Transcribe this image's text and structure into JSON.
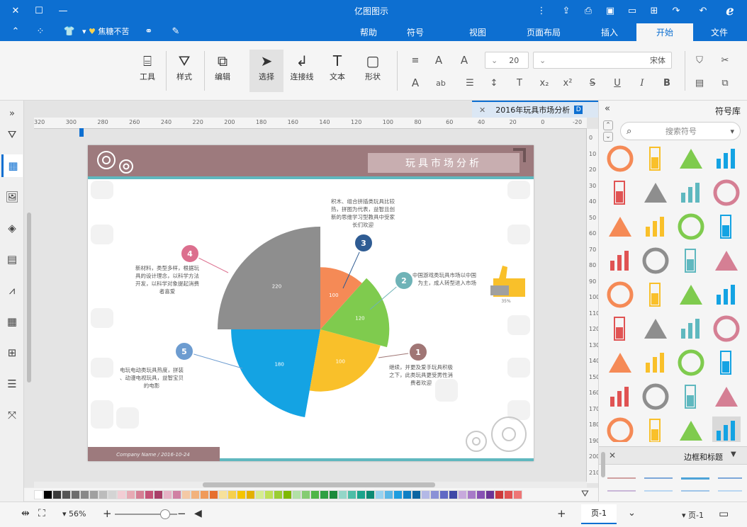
{
  "app": {
    "title": "亿图图示"
  },
  "menu": {
    "file": "文件",
    "start": "开始",
    "insert": "插入",
    "page_layout": "页面布局",
    "view": "视图",
    "symbol": "符号",
    "help": "帮助",
    "user_name": "焦糖不苦",
    "active": "开始"
  },
  "ribbon": {
    "tools": {
      "tool": "工具",
      "style": "样式",
      "edit": "编辑",
      "select": "选择",
      "connector": "连接线",
      "text": "文本",
      "shape": "形状"
    },
    "font": {
      "name": "宋体",
      "size": "20"
    },
    "text_buttons": {
      "increase": "A",
      "decrease": "A",
      "bold": "B",
      "italic": "I",
      "underline": "U",
      "strike": "S",
      "superscript": "x²",
      "subscript": "x₂",
      "text_t": "T",
      "ab": "ab",
      "font_color": "A"
    }
  },
  "document": {
    "tab_title": "2016年玩具市场分析"
  },
  "ruler": {
    "horizontal": [
      "-20",
      "0",
      "20",
      "40",
      "60",
      "80",
      "100",
      "120",
      "140",
      "160",
      "180",
      "200",
      "220",
      "240",
      "260",
      "280",
      "300",
      "320"
    ],
    "vertical": [
      "0",
      "10",
      "20",
      "30",
      "40",
      "50",
      "60",
      "70",
      "80",
      "90",
      "100",
      "110",
      "120",
      "130",
      "140",
      "150",
      "160",
      "170",
      "180",
      "190",
      "200",
      "210"
    ]
  },
  "slide": {
    "title": "玩具市场分析",
    "footer": "Company Name  /  2016-10-24",
    "accent_colors": {
      "header": "#9d7a7d",
      "teal": "#5fb8bf"
    },
    "callouts": [
      {
        "num": "1",
        "color": "#a07675",
        "text": "继续，并更及爱手玩具积极之下，此类玩具更受男性消费者欢迎"
      },
      {
        "num": "2",
        "color": "#6fb3b7",
        "text": "中国游戏类玩具市场以中国为主，成人转型进入市场"
      },
      {
        "num": "3",
        "color": "#2f5c93",
        "text": "积木、组合拼插类玩具比较热，拼图为代表，益智且创新的思维学习型教具中受家长们欢迎"
      },
      {
        "num": "4",
        "color": "#dc6f8e",
        "text": "新材料，类型多样，根据玩具的设计理念，以科学方法开发，以科学对象提起消费者喜爱"
      },
      {
        "num": "5",
        "color": "#6d9cd0",
        "text": "电玩电动类玩具热度，拼装、动漫电视玩具，益智宝贝的电影"
      }
    ],
    "thumb_note": "35%"
  },
  "chart_data": {
    "type": "pie",
    "categories": [
      "1",
      "2",
      "3",
      "4",
      "5"
    ],
    "values": [
      100,
      120,
      100,
      220,
      180
    ],
    "colors": [
      "#f9c02a",
      "#7fcb4e",
      "#f58a56",
      "#8e8e8e",
      "#14a3e3"
    ],
    "title": "",
    "legend": "none"
  },
  "palette_colors": [
    "#ffffff",
    "#000000",
    "#3a3a3a",
    "#555555",
    "#6d6d6d",
    "#888888",
    "#a0a0a0",
    "#bcbcbc",
    "#d4d4d4",
    "#f2cdd4",
    "#e7aab4",
    "#d57f94",
    "#c45377",
    "#a83f68",
    "#e6b3c6",
    "#d080a3",
    "#f4c9a5",
    "#f2b27c",
    "#f09a5a",
    "#e66f2f",
    "#f7e19b",
    "#f6d04d",
    "#f5c400",
    "#e3b000",
    "#d5ec8f",
    "#bee056",
    "#9acd32",
    "#7fb800",
    "#b2e0a6",
    "#84cc72",
    "#4fb547",
    "#2ea043",
    "#1b8a3a",
    "#94d6c8",
    "#4dbda6",
    "#1aa38b",
    "#0b8a73",
    "#98d2ef",
    "#5bb7e6",
    "#1e9ddf",
    "#0f7fc4",
    "#0c64a1",
    "#b3b8e6",
    "#8a91d6",
    "#5f68c4",
    "#3e47a7",
    "#c7a9dc",
    "#a77ac8",
    "#8751b3",
    "#6b3596",
    "#cc3a3a",
    "#e05353",
    "#ee7676"
  ],
  "symbols_panel": {
    "title": "符号库",
    "search_placeholder": "搜索符号",
    "section": "边框和标题"
  },
  "status": {
    "page_left": "页-1",
    "page_tab": "页-1",
    "zoom": "56%"
  }
}
